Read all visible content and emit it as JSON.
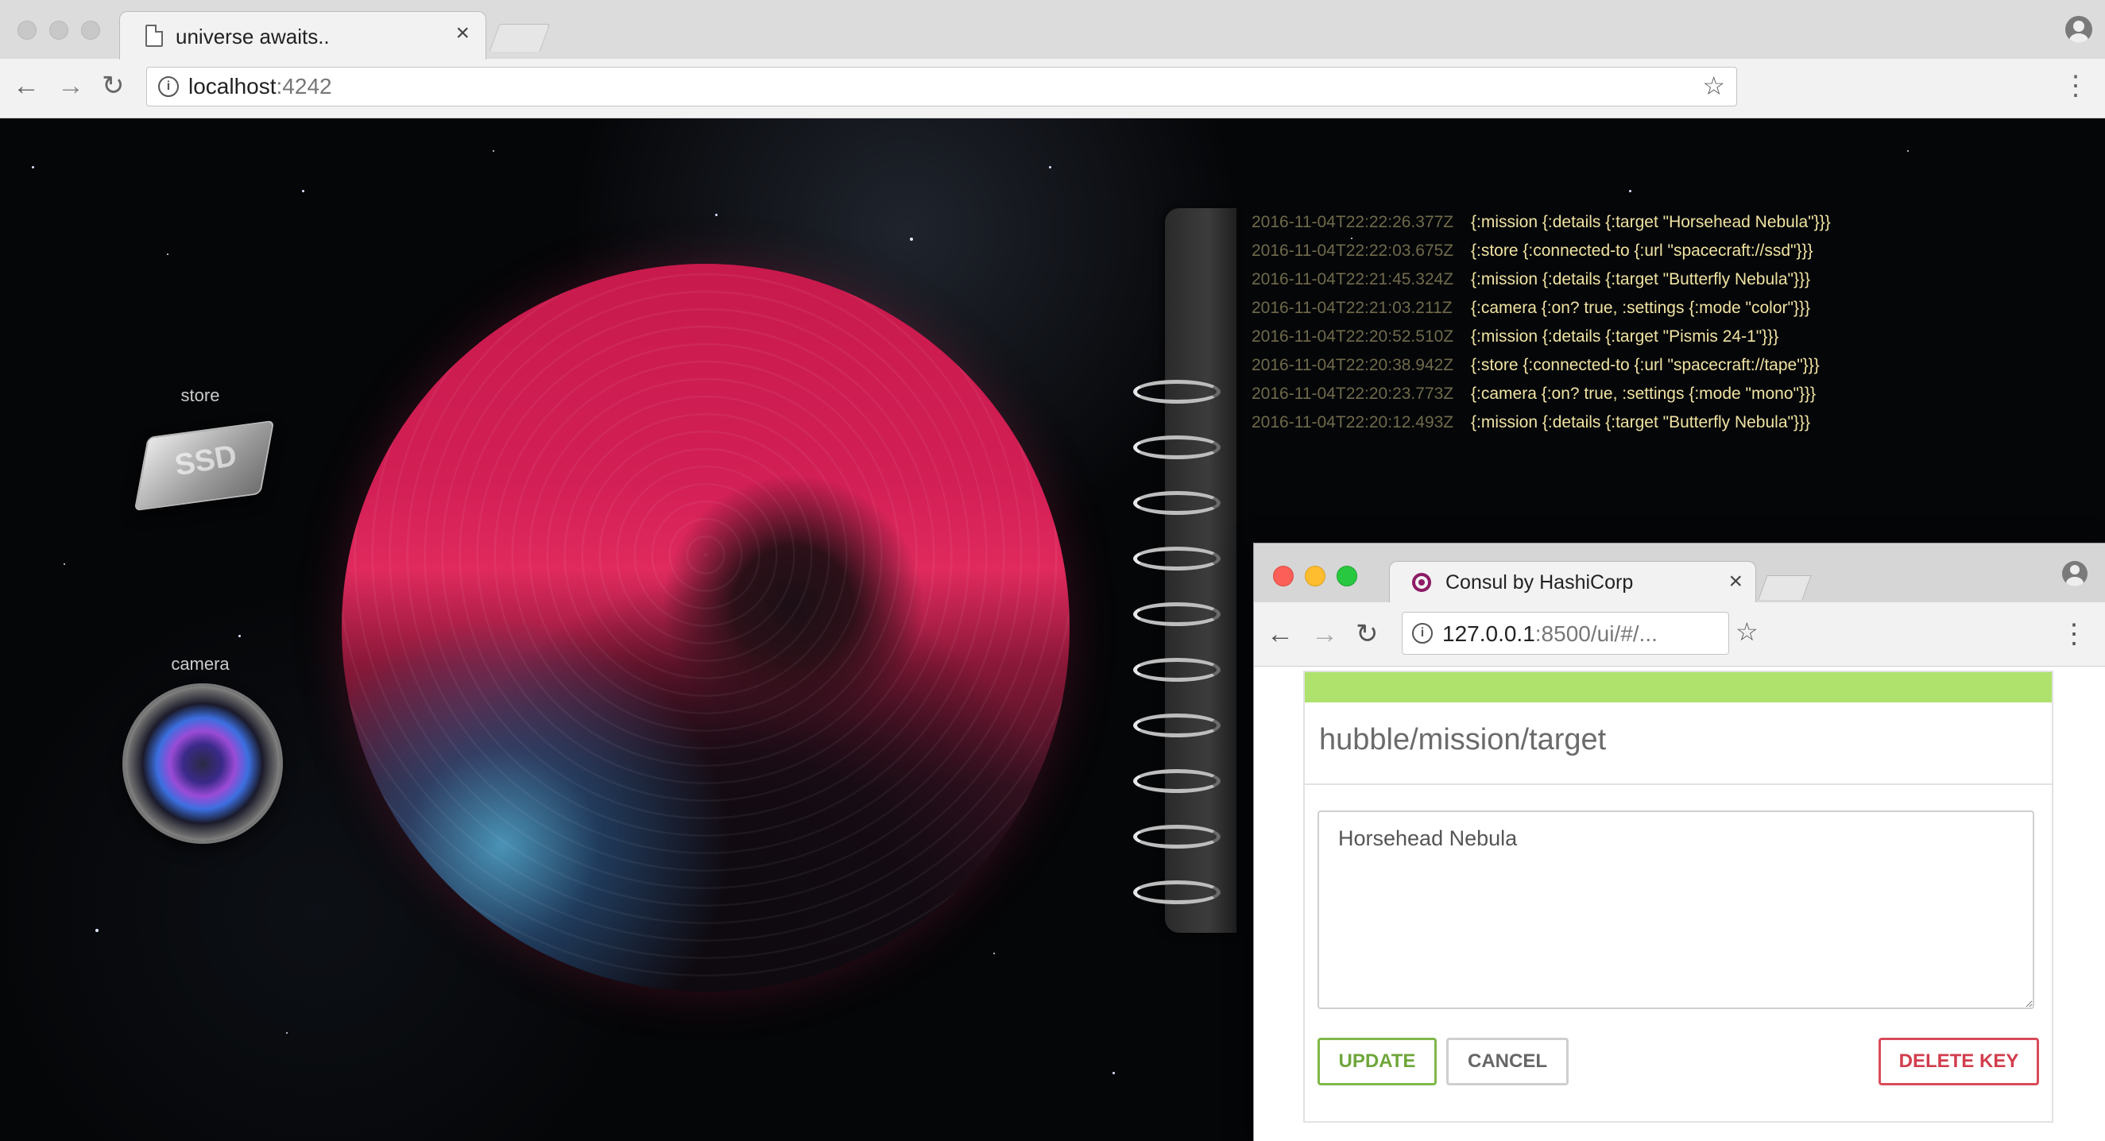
{
  "browser": {
    "tab_title": "universe awaits..",
    "url_host": "localhost",
    "url_port": ":4242"
  },
  "widgets": {
    "store_label": "store",
    "camera_label": "camera",
    "ssd_text": "SSD"
  },
  "log": [
    {
      "ts": "2016-11-04T22:22:26.377Z",
      "msg": "{:mission {:details {:target \"Horsehead Nebula\"}}}"
    },
    {
      "ts": "2016-11-04T22:22:03.675Z",
      "msg": "{:store {:connected-to {:url \"spacecraft://ssd\"}}}"
    },
    {
      "ts": "2016-11-04T22:21:45.324Z",
      "msg": "{:mission {:details {:target \"Butterfly Nebula\"}}}"
    },
    {
      "ts": "2016-11-04T22:21:03.211Z",
      "msg": "{:camera {:on? true, :settings {:mode \"color\"}}}"
    },
    {
      "ts": "2016-11-04T22:20:52.510Z",
      "msg": "{:mission {:details {:target \"Pismis 24-1\"}}}"
    },
    {
      "ts": "2016-11-04T22:20:38.942Z",
      "msg": "{:store {:connected-to {:url \"spacecraft://tape\"}}}"
    },
    {
      "ts": "2016-11-04T22:20:23.773Z",
      "msg": "{:camera {:on? true, :settings {:mode \"mono\"}}}"
    },
    {
      "ts": "2016-11-04T22:20:12.493Z",
      "msg": "{:mission {:details {:target \"Butterfly Nebula\"}}}"
    }
  ],
  "popup": {
    "tab_title": "Consul by HashiCorp",
    "url_host": "127.0.0.1",
    "url_rest": ":8500/ui/#/...",
    "key_path": "hubble/mission/target",
    "value": "Horsehead Nebula",
    "update_label": "UPDATE",
    "cancel_label": "CANCEL",
    "delete_label": "DELETE KEY"
  },
  "colors": {
    "log_ts": "#6f6a4a",
    "log_msg": "#f0e3a2",
    "consul_bar": "#aee26c",
    "update": "#7fb84a",
    "delete": "#d94b5a"
  }
}
